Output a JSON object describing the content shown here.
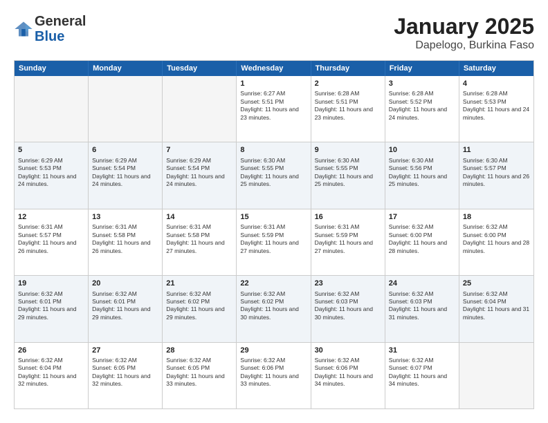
{
  "header": {
    "logo": {
      "general": "General",
      "blue": "Blue"
    },
    "title": "January 2025",
    "subtitle": "Dapelogo, Burkina Faso"
  },
  "days": [
    "Sunday",
    "Monday",
    "Tuesday",
    "Wednesday",
    "Thursday",
    "Friday",
    "Saturday"
  ],
  "rows": [
    [
      {
        "day": "",
        "empty": true
      },
      {
        "day": "",
        "empty": true
      },
      {
        "day": "",
        "empty": true
      },
      {
        "day": "1",
        "sunrise": "6:27 AM",
        "sunset": "5:51 PM",
        "daylight": "11 hours and 23 minutes."
      },
      {
        "day": "2",
        "sunrise": "6:28 AM",
        "sunset": "5:51 PM",
        "daylight": "11 hours and 23 minutes."
      },
      {
        "day": "3",
        "sunrise": "6:28 AM",
        "sunset": "5:52 PM",
        "daylight": "11 hours and 24 minutes."
      },
      {
        "day": "4",
        "sunrise": "6:28 AM",
        "sunset": "5:53 PM",
        "daylight": "11 hours and 24 minutes."
      }
    ],
    [
      {
        "day": "5",
        "sunrise": "6:29 AM",
        "sunset": "5:53 PM",
        "daylight": "11 hours and 24 minutes."
      },
      {
        "day": "6",
        "sunrise": "6:29 AM",
        "sunset": "5:54 PM",
        "daylight": "11 hours and 24 minutes."
      },
      {
        "day": "7",
        "sunrise": "6:29 AM",
        "sunset": "5:54 PM",
        "daylight": "11 hours and 24 minutes."
      },
      {
        "day": "8",
        "sunrise": "6:30 AM",
        "sunset": "5:55 PM",
        "daylight": "11 hours and 25 minutes."
      },
      {
        "day": "9",
        "sunrise": "6:30 AM",
        "sunset": "5:55 PM",
        "daylight": "11 hours and 25 minutes."
      },
      {
        "day": "10",
        "sunrise": "6:30 AM",
        "sunset": "5:56 PM",
        "daylight": "11 hours and 25 minutes."
      },
      {
        "day": "11",
        "sunrise": "6:30 AM",
        "sunset": "5:57 PM",
        "daylight": "11 hours and 26 minutes."
      }
    ],
    [
      {
        "day": "12",
        "sunrise": "6:31 AM",
        "sunset": "5:57 PM",
        "daylight": "11 hours and 26 minutes."
      },
      {
        "day": "13",
        "sunrise": "6:31 AM",
        "sunset": "5:58 PM",
        "daylight": "11 hours and 26 minutes."
      },
      {
        "day": "14",
        "sunrise": "6:31 AM",
        "sunset": "5:58 PM",
        "daylight": "11 hours and 27 minutes."
      },
      {
        "day": "15",
        "sunrise": "6:31 AM",
        "sunset": "5:59 PM",
        "daylight": "11 hours and 27 minutes."
      },
      {
        "day": "16",
        "sunrise": "6:31 AM",
        "sunset": "5:59 PM",
        "daylight": "11 hours and 27 minutes."
      },
      {
        "day": "17",
        "sunrise": "6:32 AM",
        "sunset": "6:00 PM",
        "daylight": "11 hours and 28 minutes."
      },
      {
        "day": "18",
        "sunrise": "6:32 AM",
        "sunset": "6:00 PM",
        "daylight": "11 hours and 28 minutes."
      }
    ],
    [
      {
        "day": "19",
        "sunrise": "6:32 AM",
        "sunset": "6:01 PM",
        "daylight": "11 hours and 29 minutes."
      },
      {
        "day": "20",
        "sunrise": "6:32 AM",
        "sunset": "6:01 PM",
        "daylight": "11 hours and 29 minutes."
      },
      {
        "day": "21",
        "sunrise": "6:32 AM",
        "sunset": "6:02 PM",
        "daylight": "11 hours and 29 minutes."
      },
      {
        "day": "22",
        "sunrise": "6:32 AM",
        "sunset": "6:02 PM",
        "daylight": "11 hours and 30 minutes."
      },
      {
        "day": "23",
        "sunrise": "6:32 AM",
        "sunset": "6:03 PM",
        "daylight": "11 hours and 30 minutes."
      },
      {
        "day": "24",
        "sunrise": "6:32 AM",
        "sunset": "6:03 PM",
        "daylight": "11 hours and 31 minutes."
      },
      {
        "day": "25",
        "sunrise": "6:32 AM",
        "sunset": "6:04 PM",
        "daylight": "11 hours and 31 minutes."
      }
    ],
    [
      {
        "day": "26",
        "sunrise": "6:32 AM",
        "sunset": "6:04 PM",
        "daylight": "11 hours and 32 minutes."
      },
      {
        "day": "27",
        "sunrise": "6:32 AM",
        "sunset": "6:05 PM",
        "daylight": "11 hours and 32 minutes."
      },
      {
        "day": "28",
        "sunrise": "6:32 AM",
        "sunset": "6:05 PM",
        "daylight": "11 hours and 33 minutes."
      },
      {
        "day": "29",
        "sunrise": "6:32 AM",
        "sunset": "6:06 PM",
        "daylight": "11 hours and 33 minutes."
      },
      {
        "day": "30",
        "sunrise": "6:32 AM",
        "sunset": "6:06 PM",
        "daylight": "11 hours and 34 minutes."
      },
      {
        "day": "31",
        "sunrise": "6:32 AM",
        "sunset": "6:07 PM",
        "daylight": "11 hours and 34 minutes."
      },
      {
        "day": "",
        "empty": true
      }
    ]
  ],
  "labels": {
    "sunrise": "Sunrise:",
    "sunset": "Sunset:",
    "daylight": "Daylight:"
  }
}
